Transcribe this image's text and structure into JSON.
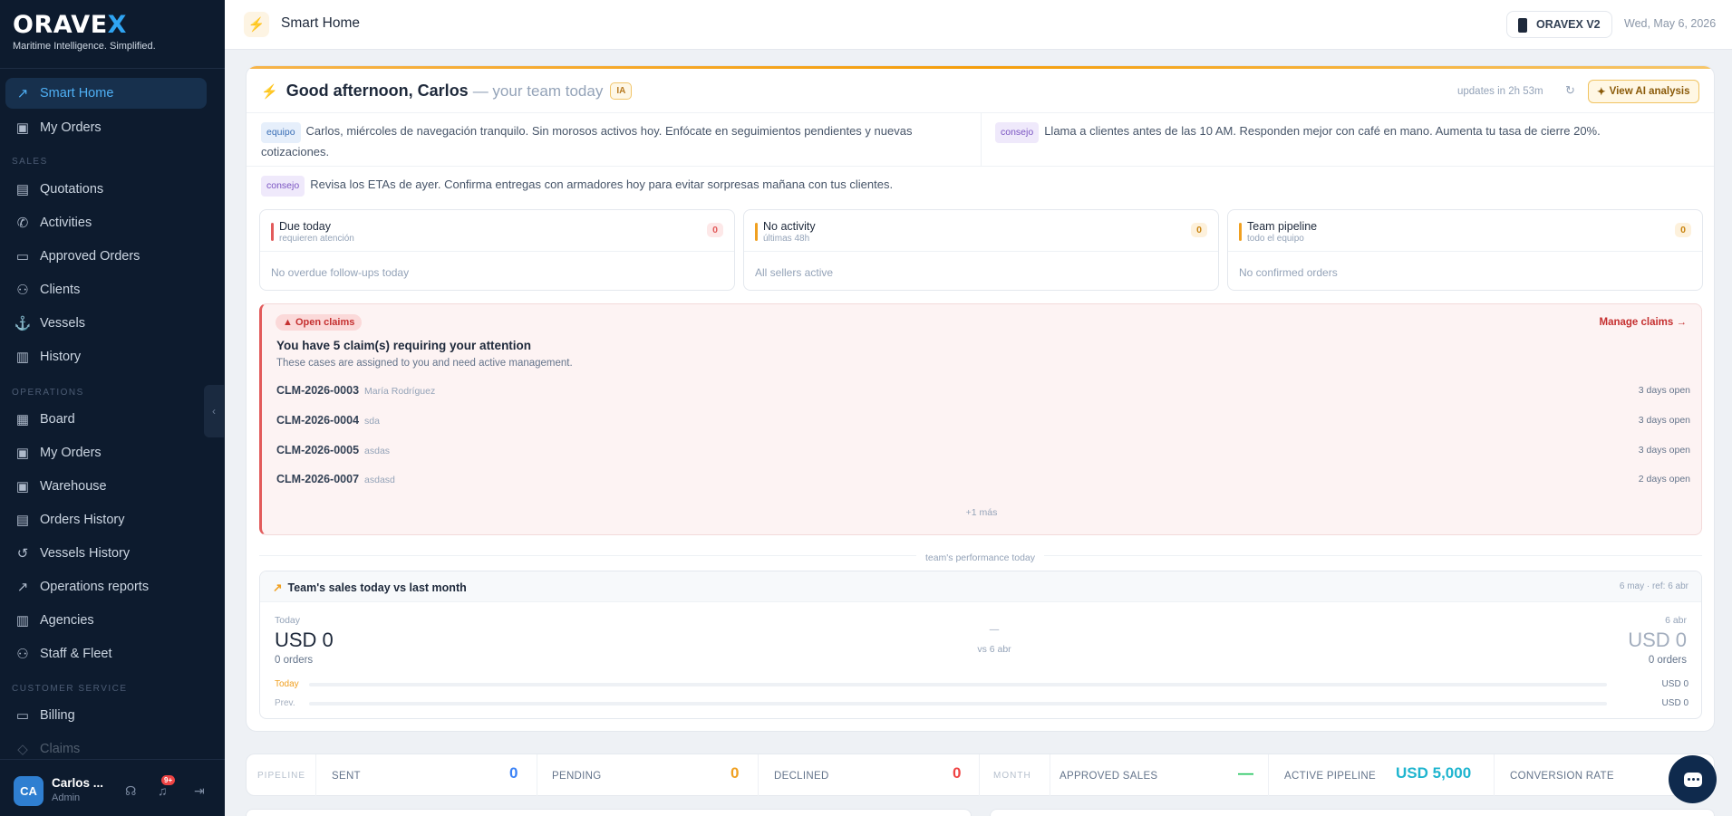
{
  "sidebar": {
    "logo": "ORAVE",
    "logo_x": "X",
    "tagline": "Maritime Intelligence. Simplified.",
    "sections": {
      "sales": "SALES",
      "operations": "OPERATIONS",
      "customer_service": "CUSTOMER SERVICE"
    },
    "items": [
      {
        "label": "Smart Home",
        "icon": "chart-line-icon",
        "active": true
      },
      {
        "label": "My Orders",
        "icon": "box-icon"
      },
      {
        "label": "Quotations",
        "icon": "document-icon"
      },
      {
        "label": "Activities",
        "icon": "phone-icon"
      },
      {
        "label": "Approved Orders",
        "icon": "card-icon"
      },
      {
        "label": "Clients",
        "icon": "users-icon"
      },
      {
        "label": "Vessels",
        "icon": "anchor-icon"
      },
      {
        "label": "History",
        "icon": "book-icon"
      },
      {
        "label": "Board",
        "icon": "board-icon"
      },
      {
        "label": "My Orders",
        "icon": "box-icon"
      },
      {
        "label": "Warehouse",
        "icon": "warehouse-icon"
      },
      {
        "label": "Orders History",
        "icon": "clipboard-icon"
      },
      {
        "label": "Vessels History",
        "icon": "history-icon"
      },
      {
        "label": "Operations reports",
        "icon": "chart-line-icon"
      },
      {
        "label": "Agencies",
        "icon": "building-icon"
      },
      {
        "label": "Staff & Fleet",
        "icon": "team-icon"
      },
      {
        "label": "Billing",
        "icon": "card-icon"
      },
      {
        "label": "Claims",
        "icon": "claim-icon"
      }
    ],
    "user": {
      "initials": "CA",
      "name": "Carlos ...",
      "role": "Admin",
      "notifications": "9+"
    }
  },
  "topbar": {
    "title": "Smart Home",
    "version": "ORAVEX V2",
    "date": "Wed, May 6, 2026"
  },
  "greeting": {
    "main": "Good afternoon, Carlos",
    "sub": "— your team today",
    "ia_badge": "IA",
    "updates": "updates in 2h 53m",
    "view_ai": "View AI analysis"
  },
  "tips": [
    {
      "tag": "equipo",
      "text": "Carlos, miércoles de navegación tranquilo. Sin morosos activos hoy. Enfócate en seguimientos pendientes y nuevas cotizaciones."
    },
    {
      "tag": "consejo",
      "text": "Llama a clientes antes de las 10 AM. Responden mejor con café en mano. Aumenta tu tasa de cierre 20%."
    },
    {
      "tag": "consejo",
      "text": "Revisa los ETAs de ayer. Confirma entregas con armadores hoy para evitar sorpresas mañana con tus clientes."
    }
  ],
  "stats": [
    {
      "title": "Due today",
      "sub": "requieren atención",
      "count": "0",
      "empty": "No overdue follow-ups today",
      "color": "#e25b5b"
    },
    {
      "title": "No activity",
      "sub": "últimas 48h",
      "count": "0",
      "empty": "All sellers active",
      "color": "#f0a020"
    },
    {
      "title": "Team pipeline",
      "sub": "todo el equipo",
      "count": "0",
      "empty": "No confirmed orders",
      "color": "#f0a020"
    }
  ],
  "claims": {
    "badge": "Open claims",
    "title": "You have 5 claim(s) requiring your attention",
    "desc": "These cases are assigned to you and need active management.",
    "manage": "Manage claims →",
    "rows": [
      {
        "id": "CLM-2026-0003",
        "client": "María Rodríguez",
        "open": "3 days open"
      },
      {
        "id": "CLM-2026-0004",
        "client": "sda",
        "open": "3 days open"
      },
      {
        "id": "CLM-2026-0005",
        "client": "asdas",
        "open": "3 days open"
      },
      {
        "id": "CLM-2026-0007",
        "client": "asdasd",
        "open": "2 days open"
      }
    ],
    "more": "+1 más"
  },
  "performance": {
    "separator": "team's performance today",
    "title": "Team's sales today vs last month",
    "range": "6 may · ref: 6 abr",
    "today_label": "Today",
    "today_value": "USD 0",
    "today_orders": "0 orders",
    "vs_dash": "—",
    "vs_label": "vs 6 abr",
    "ref_label": "6 abr",
    "ref_value": "USD 0",
    "ref_orders": "0 orders",
    "bars": [
      {
        "label": "Today",
        "value": "USD 0",
        "fill": 0,
        "color": "#f0a020"
      },
      {
        "label": "Prev.",
        "value": "USD 0",
        "fill": 0,
        "color": "#a3aebe"
      }
    ]
  },
  "pipeline": {
    "section_pipeline": "PIPELINE",
    "section_month": "MONTH",
    "sent_label": "SENT",
    "sent_value": "0",
    "sent_color": "#3b82f6",
    "pending_label": "PENDING",
    "pending_value": "0",
    "pending_color": "#f0a020",
    "declined_label": "DECLINED",
    "declined_value": "0",
    "declined_color": "#ef4444",
    "approved_label": "APPROVED SALES",
    "approved_value": "—",
    "approved_color": "#22c55e",
    "active_label": "ACTIVE PIPELINE",
    "active_value": "USD 5,000",
    "active_color": "#1fb5cf",
    "conversion_label": "CONVERSION RATE"
  }
}
